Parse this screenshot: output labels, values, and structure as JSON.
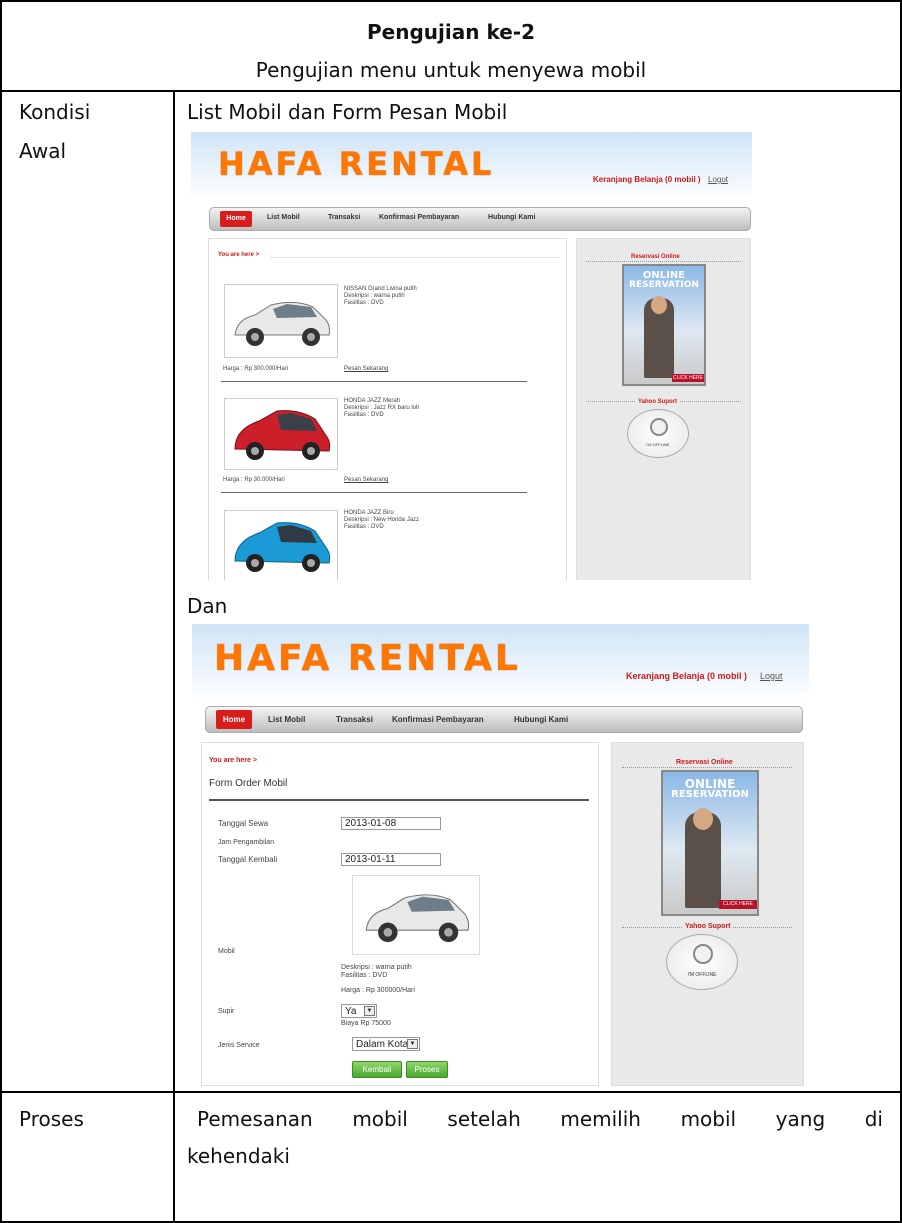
{
  "heading": {
    "title": "Pengujian ke-2",
    "subtitle": "Pengujian menu untuk menyewa mobil"
  },
  "rows": {
    "kondisi_label_line1": "Kondisi",
    "kondisi_label_line2": "Awal",
    "kondisi_text": "List Mobil dan Form Pesan Mobil",
    "dan": "Dan",
    "proses_label": "Proses",
    "proses_line1": [
      "Pemesanan",
      "mobil",
      "setelah",
      "memilih",
      "mobil",
      "yang",
      "di"
    ],
    "proses_line2": "kehendaki"
  },
  "site": {
    "logo": "HAFA RENTAL",
    "cart": "Keranjang Belanja (0 mobil )",
    "logout": "Logut",
    "nav": [
      "Home",
      "List Mobil",
      "Transaksi",
      "Konfirmasi Pembayaran",
      "Hubungi Kami"
    ],
    "breadcrumb": "You are here >",
    "reservasi": "Reservasi Online",
    "banner_line1": "ONLINE",
    "banner_line2": "RESERVATION",
    "banner_cta": "CLICK HERE",
    "yahoo": "Yahoo Suport",
    "yahoo_status": "I'M OFFLINE"
  },
  "cars": [
    {
      "name": "NISSAN Grand Livina putih",
      "desc": "Deskripsi : warna putih",
      "fasilitas": "Fasilitas : DVD",
      "harga": "Harga : Rp 300.000/Hari",
      "link": "Pesan Sekarang",
      "color": "#e8e8e8"
    },
    {
      "name": "HONDA JAZZ Merah",
      "desc": "Deskripsi : Jazz RX baru loh",
      "fasilitas": "Fasilitas : DVD",
      "harga": "Harga : Rp 30.000/Hari",
      "link": "Pesan Sekarang",
      "color": "#cc1f2a"
    },
    {
      "name": "HONDA JAZZ Biru",
      "desc": "Deskripsi : New Honda Jazz",
      "fasilitas": "Fasilitas : DVD",
      "color": "#1c9ad6"
    }
  ],
  "form": {
    "title": "Form Order Mobil",
    "tanggal_sewa_label": "Tanggal Sewa",
    "tanggal_sewa_value": "2013-01-08",
    "jam_label": "Jam Pengambilan",
    "tanggal_kembali_label": "Tanggal Kembali",
    "tanggal_kembali_value": "2013-01-11",
    "mobil_label": "Mobil",
    "mobil_desc": "Deskripsi : warna putih",
    "mobil_fasilitas": "Fasilitas : DVD",
    "mobil_harga": "Harga : Rp 300000/Hari",
    "supir_label": "Supir",
    "supir_value": "Ya",
    "biaya": "Biaya Rp 75000",
    "jenis_label": "Jenis Service",
    "jenis_value": "Dalam Kota",
    "btn_kembali": "Kembali",
    "btn_proses": "Proses"
  }
}
